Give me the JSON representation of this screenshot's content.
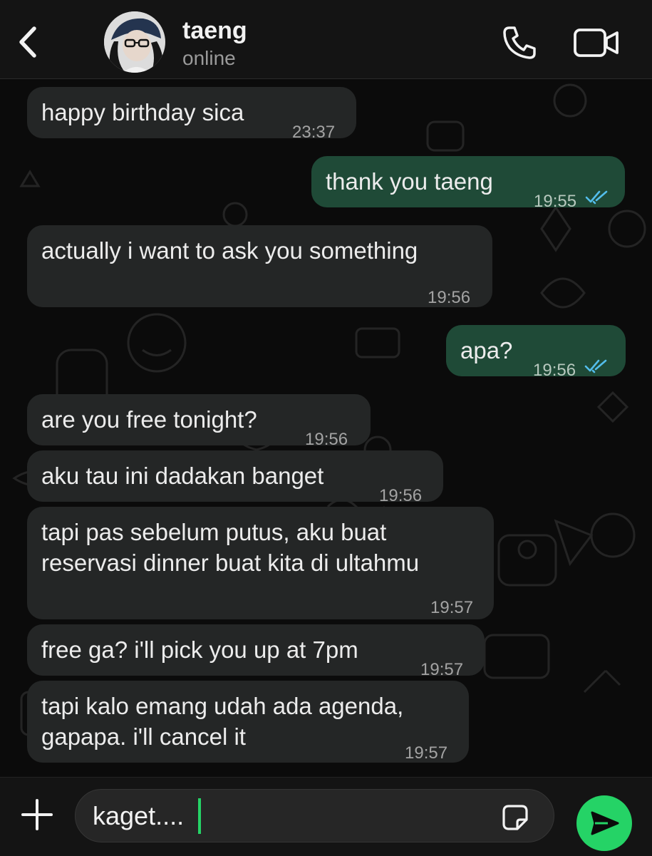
{
  "header": {
    "contact_name": "taeng",
    "contact_status": "online"
  },
  "messages": [
    {
      "direction": "in",
      "text": "happy birthday sica",
      "time": "23:37"
    },
    {
      "direction": "out",
      "text": "thank you taeng",
      "time": "19:55",
      "status": "read"
    },
    {
      "direction": "in",
      "text": "actually i want to ask you something",
      "time": "19:56"
    },
    {
      "direction": "out",
      "text": "apa?",
      "time": "19:56",
      "status": "read"
    },
    {
      "direction": "in",
      "text": "are you free tonight?",
      "time": "19:56"
    },
    {
      "direction": "in",
      "text": "aku tau ini dadakan banget",
      "time": "19:56"
    },
    {
      "direction": "in",
      "text": "tapi pas sebelum putus, aku buat\nreservasi dinner buat kita di ultahmu",
      "time": "19:57"
    },
    {
      "direction": "in",
      "text": "free ga? i'll pick you up at 7pm",
      "time": "19:57"
    },
    {
      "direction": "in",
      "text": "tapi kalo emang udah ada agenda,\ngapapa. i'll cancel it",
      "time": "19:57"
    }
  ],
  "composer": {
    "draft_text": "kaget...."
  },
  "colors": {
    "incoming_bubble": "#242626",
    "outgoing_bubble": "#1f4a37",
    "read_ticks": "#53bdeb",
    "send_button": "#25d366"
  },
  "icons": {
    "back": "chevron-left-icon",
    "call": "phone-icon",
    "video": "video-camera-icon",
    "attach": "plus-icon",
    "sticker": "sticker-icon",
    "send": "send-icon"
  }
}
